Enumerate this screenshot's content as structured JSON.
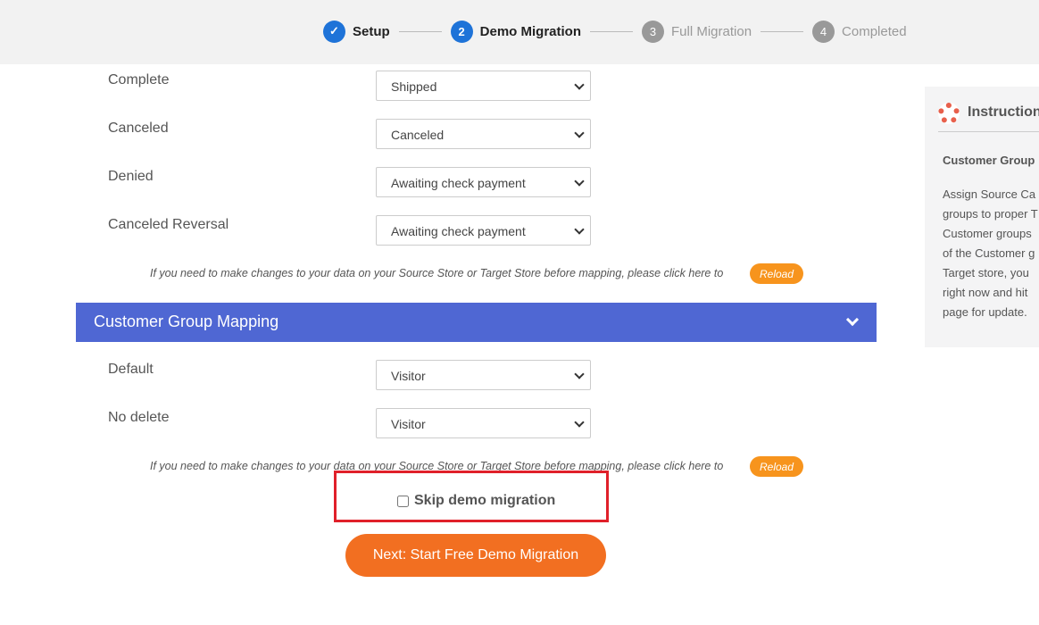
{
  "steps": [
    {
      "num": "✓",
      "label": "Setup"
    },
    {
      "num": "2",
      "label": "Demo Migration"
    },
    {
      "num": "3",
      "label": "Full Migration"
    },
    {
      "num": "4",
      "label": "Completed"
    }
  ],
  "order_status_rows": [
    {
      "label": "Complete",
      "value": "Shipped"
    },
    {
      "label": "Canceled",
      "value": "Canceled"
    },
    {
      "label": "Denied",
      "value": "Awaiting check payment"
    },
    {
      "label": "Canceled Reversal",
      "value": "Awaiting check payment"
    }
  ],
  "note": "If you need to make changes to your data on your Source Store or Target Store before mapping, please click here to",
  "reload_label": "Reload",
  "customer_group": {
    "title": "Customer Group Mapping",
    "rows": [
      {
        "label": "Default",
        "value": "Visitor"
      },
      {
        "label": "No delete",
        "value": "Visitor"
      }
    ]
  },
  "skip_label": "Skip demo migration",
  "next_label": "Next: Start Free Demo Migration",
  "instructions": {
    "title": "Instructions",
    "heading": "Customer Group",
    "lines": [
      "Assign Source Ca",
      "groups to proper T",
      "Customer groups",
      "of the Customer g",
      "Target store, you",
      "right now and hit",
      "page for update."
    ]
  },
  "colors": {
    "accent": "#1e73d8",
    "band": "#4f67d3",
    "orange": "#f26f21",
    "highlight": "#e0202a"
  }
}
